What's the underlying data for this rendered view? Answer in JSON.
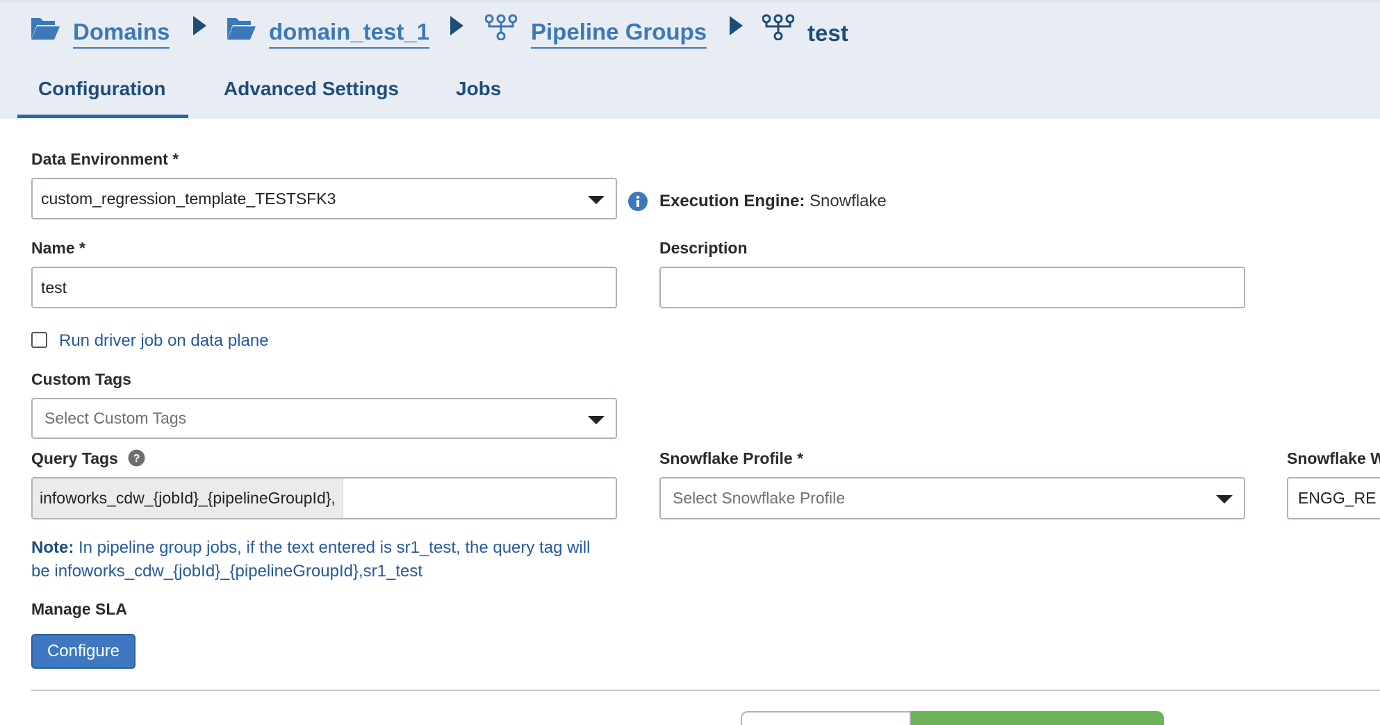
{
  "breadcrumb": {
    "items": [
      {
        "label": "Domains",
        "icon": "folder-open-icon"
      },
      {
        "label": "domain_test_1",
        "icon": "folder-open-icon"
      },
      {
        "label": "Pipeline Groups",
        "icon": "pipeline-icon"
      },
      {
        "label": "test",
        "icon": "pipeline-icon"
      }
    ]
  },
  "tabs": [
    {
      "label": "Configuration",
      "active": true
    },
    {
      "label": "Advanced Settings",
      "active": false
    },
    {
      "label": "Jobs",
      "active": false
    }
  ],
  "form": {
    "data_environment": {
      "label": "Data Environment *",
      "value": "custom_regression_template_TESTSFK3"
    },
    "execution_engine": {
      "label": "Execution Engine:",
      "value": "Snowflake"
    },
    "name": {
      "label": "Name *",
      "value": "test"
    },
    "description": {
      "label": "Description",
      "value": ""
    },
    "run_driver": {
      "label": "Run driver job on data plane",
      "checked": false
    },
    "custom_tags": {
      "label": "Custom Tags",
      "placeholder": "Select Custom Tags"
    },
    "query_tags": {
      "label": "Query Tags",
      "chip": "infoworks_cdw_{jobId}_{pipelineGroupId},"
    },
    "snowflake_profile": {
      "label": "Snowflake Profile *",
      "placeholder": "Select Snowflake Profile"
    },
    "snowflake_warehouse": {
      "label": "Snowflake W",
      "value": "ENGG_RE"
    },
    "note": {
      "prefix": "Note:",
      "line1": " In pipeline group jobs, if the text entered is sr1_test, the query tag will",
      "line2": "be infoworks_cdw_{jobId}_{pipelineGroupId},sr1_test"
    },
    "manage_sla": {
      "label": "Manage SLA",
      "button": "Configure"
    }
  },
  "colors": {
    "accent": "#3d78b8",
    "dark_blue": "#1f4d7a",
    "header_bg": "#e8edf4",
    "success": "#6cb35a"
  }
}
